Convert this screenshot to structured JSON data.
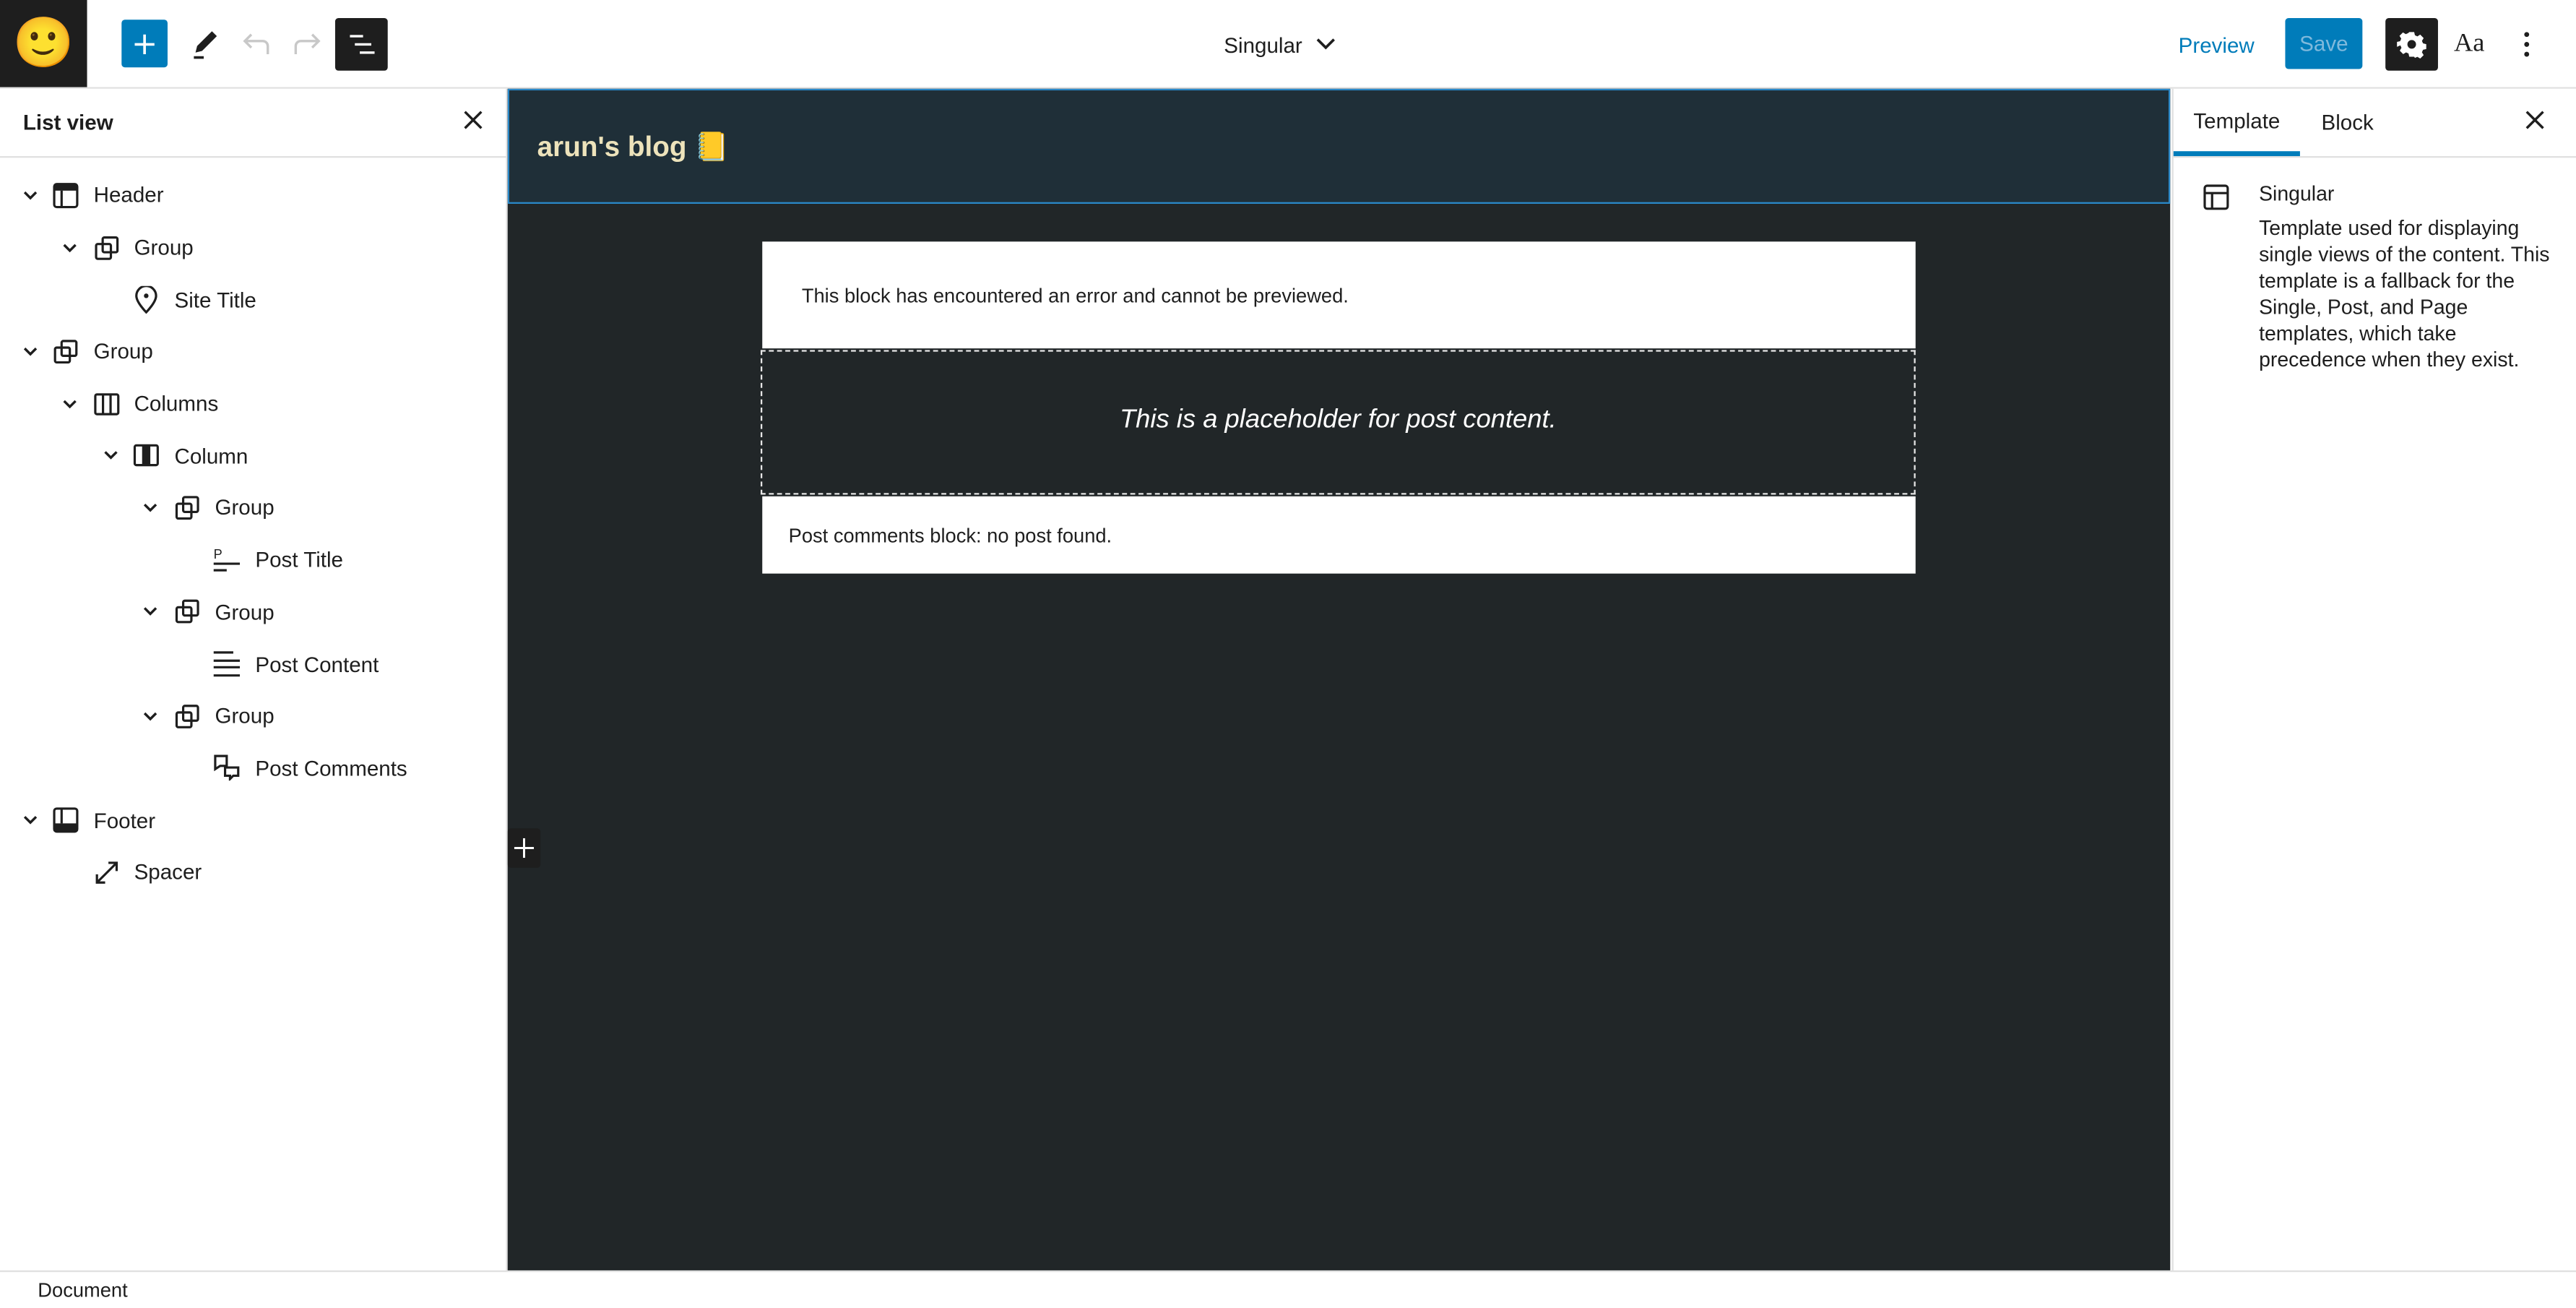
{
  "topbar": {
    "site_icon": "🙂",
    "inserter_icon": "plus-icon",
    "tools_icon": "pencil-icon",
    "undo_icon": "undo-icon",
    "redo_icon": "redo-icon",
    "list_view_icon": "list-view-icon",
    "document_title": "Singular",
    "preview_label": "Preview",
    "save_label": "Save",
    "styles_label": "Aa",
    "accent_color": "#007cba"
  },
  "list_view": {
    "title": "List view",
    "close_label": "×",
    "items": [
      {
        "label": "Header",
        "icon": "template-part-header-icon",
        "level": 0,
        "expanded": true
      },
      {
        "label": "Group",
        "icon": "group-icon",
        "level": 1,
        "expanded": true
      },
      {
        "label": "Site Title",
        "icon": "map-marker-icon",
        "level": 2,
        "expanded": null
      },
      {
        "label": "Group",
        "icon": "group-icon",
        "level": 0,
        "expanded": true
      },
      {
        "label": "Columns",
        "icon": "columns-icon",
        "level": 1,
        "expanded": true
      },
      {
        "label": "Column",
        "icon": "column-icon",
        "level": 2,
        "expanded": true
      },
      {
        "label": "Group",
        "icon": "group-icon",
        "level": 3,
        "expanded": true
      },
      {
        "label": "Post Title",
        "icon": "post-title-icon",
        "level": 4,
        "expanded": null
      },
      {
        "label": "Group",
        "icon": "group-icon",
        "level": 3,
        "expanded": true
      },
      {
        "label": "Post Content",
        "icon": "post-content-icon",
        "level": 4,
        "expanded": null
      },
      {
        "label": "Group",
        "icon": "group-icon",
        "level": 3,
        "expanded": true
      },
      {
        "label": "Post Comments",
        "icon": "post-comments-icon",
        "level": 4,
        "expanded": null
      },
      {
        "label": "Footer",
        "icon": "template-part-footer-icon",
        "level": 0,
        "expanded": true
      },
      {
        "label": "Spacer",
        "icon": "spacer-icon",
        "level": 1,
        "expanded": null
      }
    ]
  },
  "canvas": {
    "site_title": "arun's blog 📒",
    "error_message": "This block has encountered an error and cannot be previewed.",
    "post_content_placeholder": "This is a placeholder for post content.",
    "post_comments_message": "Post comments block: no post found.",
    "background_color": "#212628",
    "header_background": "#1f2f38",
    "site_title_color": "#ede3bb"
  },
  "sidebar": {
    "tabs": [
      {
        "label": "Template",
        "active": true
      },
      {
        "label": "Block",
        "active": false
      }
    ],
    "close_label": "×",
    "template_name": "Singular",
    "template_description": "Template used for displaying single views of the content. This template is a fallback for the Single, Post, and Page templates, which take precedence when they exist."
  },
  "footer": {
    "breadcrumb": "Document"
  }
}
